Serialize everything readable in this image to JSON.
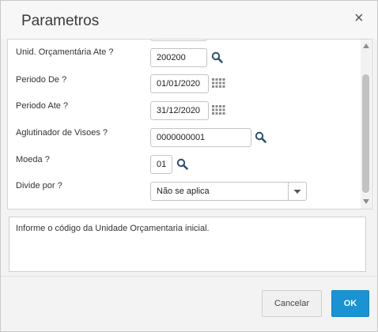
{
  "dialog": {
    "title": "Parametros",
    "close_symbol": "×",
    "close_icon": "close-icon"
  },
  "form": {
    "unid_ate": {
      "label": "Unid. Orçamentária Ate ?",
      "value": "200200",
      "icon": "search-icon"
    },
    "periodo_de": {
      "label": "Periodo De ?",
      "value": "01/01/2020",
      "icon": "calendar-icon"
    },
    "periodo_ate": {
      "label": "Periodo Ate ?",
      "value": "31/12/2020",
      "icon": "calendar-icon"
    },
    "aglutinador": {
      "label": "Aglutinador de Visoes ?",
      "value": "0000000001",
      "icon": "search-icon"
    },
    "moeda": {
      "label": "Moeda ?",
      "value": "01",
      "icon": "search-icon"
    },
    "divide_por": {
      "label": "Divide por ?",
      "value": "Não se aplica",
      "icon": "chevron-down-icon"
    }
  },
  "help": {
    "text": "Informe o código da Unidade Orçamentaria inicial."
  },
  "buttons": {
    "cancel": "Cancelar",
    "ok": "OK"
  },
  "colors": {
    "primary": "#1a93d3",
    "icon": "#2b4f73"
  }
}
